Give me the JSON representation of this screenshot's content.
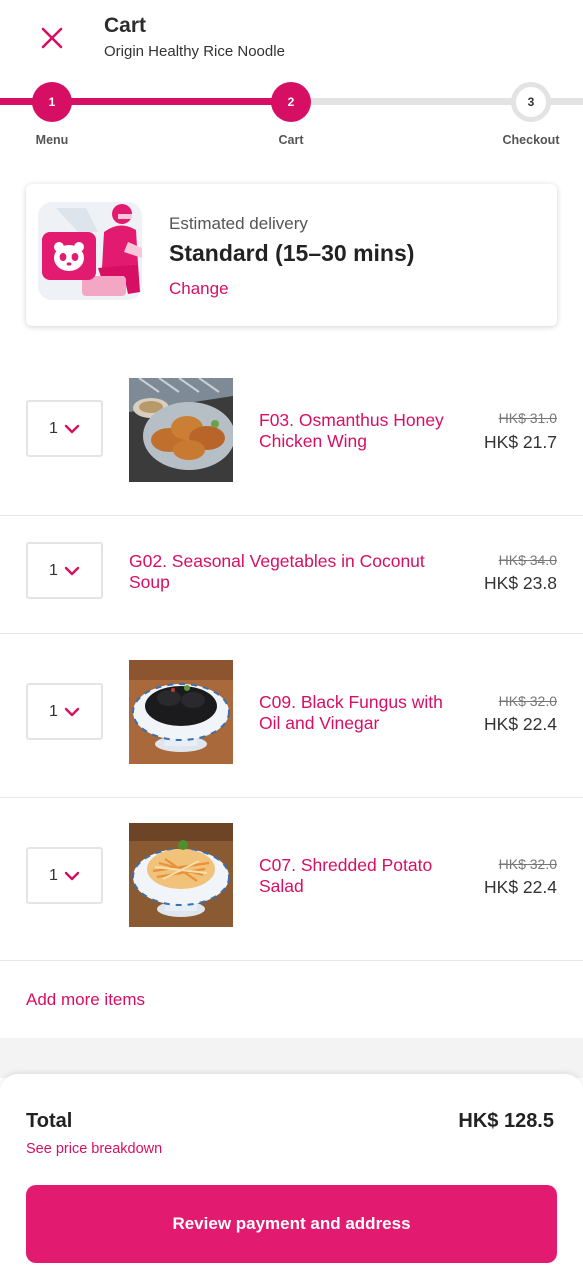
{
  "header": {
    "title": "Cart",
    "subtitle": "Origin Healthy Rice Noodle"
  },
  "stepper": {
    "steps": [
      {
        "number": "1",
        "label": "Menu",
        "state": "done"
      },
      {
        "number": "2",
        "label": "Cart",
        "state": "current"
      },
      {
        "number": "3",
        "label": "Checkout",
        "state": "upcoming"
      }
    ]
  },
  "delivery": {
    "label": "Estimated delivery",
    "type": "Standard",
    "time": "(15–30 mins)",
    "change_label": "Change"
  },
  "items": [
    {
      "quantity": "1",
      "name_line1": "F03. Osmanthus Honey",
      "name_line2": "Chicken Wing",
      "old_price": "HK$ 31.0",
      "price": "HK$ 21.7",
      "image": "chicken-wing-photo"
    },
    {
      "quantity": "1",
      "name_line1": "G02. Seasonal Vegetables in Coconut",
      "name_line2": "Soup",
      "old_price": "HK$ 34.0",
      "price": "HK$ 23.8",
      "image": null
    },
    {
      "quantity": "1",
      "name_line1": "C09. Black Fungus with",
      "name_line2": "Oil and Vinegar",
      "old_price": "HK$ 32.0",
      "price": "HK$ 22.4",
      "image": "black-fungus-photo"
    },
    {
      "quantity": "1",
      "name_line1": "C07. Shredded Potato",
      "name_line2": "Salad",
      "old_price": "HK$ 32.0",
      "price": "HK$ 22.4",
      "image": "potato-salad-photo"
    }
  ],
  "add_more_label": "Add more items",
  "summary": {
    "total_label": "Total",
    "total_value": "HK$ 128.5",
    "breakdown_label": "See price breakdown",
    "cta_label": "Review payment and address"
  },
  "colors": {
    "brand": "#d70f64",
    "button": "#e21b70",
    "track_inactive": "#e3e3e3"
  },
  "icons": {
    "close": "close-icon",
    "dropdown": "chevron-down-icon"
  }
}
